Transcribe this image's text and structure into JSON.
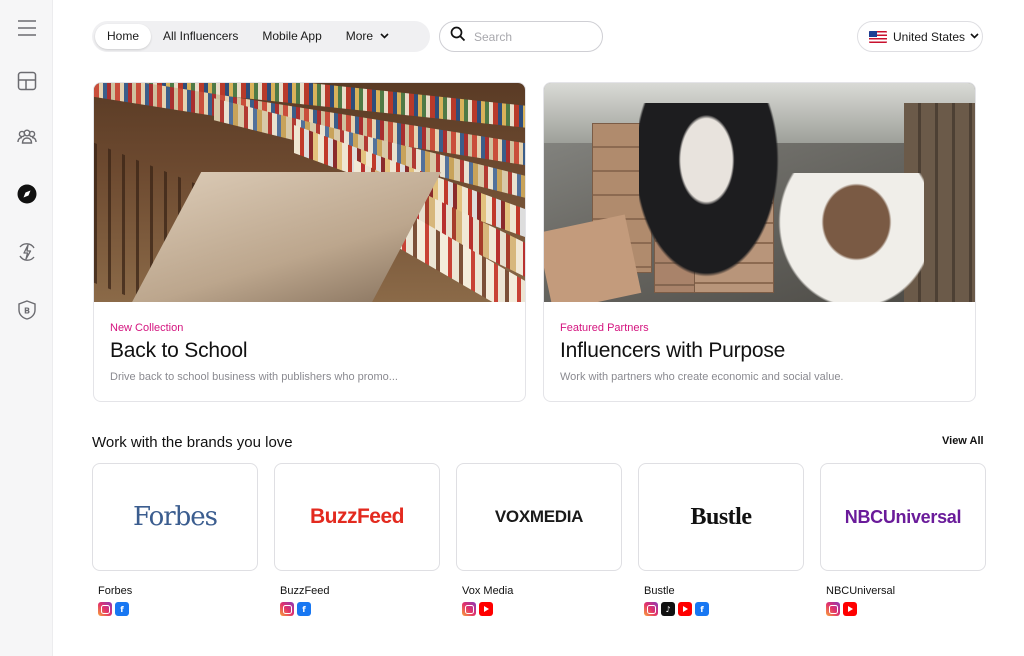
{
  "sidebar": {
    "items": [
      {
        "icon": "menu-icon"
      },
      {
        "icon": "dashboard-icon"
      },
      {
        "icon": "people-icon"
      },
      {
        "icon": "compass-icon"
      },
      {
        "icon": "lightning-icon"
      },
      {
        "icon": "badge-icon"
      }
    ]
  },
  "nav": {
    "home": "Home",
    "all_influencers": "All Influencers",
    "mobile_app": "Mobile App",
    "more": "More"
  },
  "search": {
    "placeholder": "Search"
  },
  "country": {
    "label": "United States"
  },
  "cards": [
    {
      "kicker": "New Collection",
      "title": "Back to School",
      "description": "Drive back to school business with publishers who promo..."
    },
    {
      "kicker": "Featured Partners",
      "title": "Influencers with Purpose",
      "description": "Work with partners who create economic and social value."
    }
  ],
  "brands_section": {
    "title": "Work with the brands you love",
    "view_all": "View All"
  },
  "brands": [
    {
      "logo": "Forbes",
      "name": "Forbes",
      "socials": [
        "instagram",
        "facebook"
      ]
    },
    {
      "logo": "BuzzFeed",
      "name": "BuzzFeed",
      "socials": [
        "instagram",
        "facebook"
      ]
    },
    {
      "logo": "VOXMEDIA",
      "name": "Vox Media",
      "socials": [
        "instagram",
        "youtube"
      ]
    },
    {
      "logo": "Bustle",
      "name": "Bustle",
      "socials": [
        "instagram",
        "tiktok",
        "youtube",
        "facebook"
      ]
    },
    {
      "logo": "NBCUniversal",
      "name": "NBCUniversal",
      "socials": [
        "instagram",
        "youtube"
      ]
    }
  ],
  "colors": {
    "accent_pink": "#d4147f",
    "forbes_blue": "#3b5d8f",
    "buzzfeed_red": "#e32a1f",
    "nbc_purple": "#6a1b9a"
  }
}
